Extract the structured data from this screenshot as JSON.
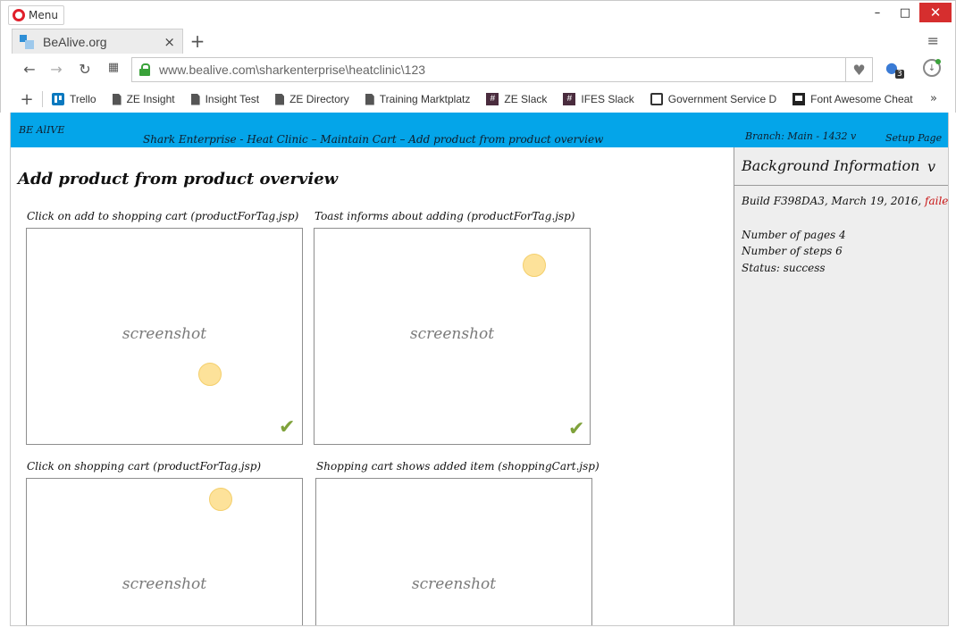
{
  "browser": {
    "menu_label": "Menu",
    "tab_title": "BeAlive.org",
    "url": "www.bealive.com\\sharkenterprise\\heatclinic\\123",
    "extension_badge": "3",
    "bookmarks": [
      {
        "label": "Trello",
        "icon": "trello-icon"
      },
      {
        "label": "ZE Insight",
        "icon": "page-icon"
      },
      {
        "label": "Insight Test",
        "icon": "page-icon"
      },
      {
        "label": "ZE Directory",
        "icon": "page-icon"
      },
      {
        "label": "Training Marktplatz",
        "icon": "page-icon"
      },
      {
        "label": "ZE Slack",
        "icon": "slack-icon"
      },
      {
        "label": "IFES Slack",
        "icon": "slack-icon"
      },
      {
        "label": "Government Service D",
        "icon": "government-icon"
      },
      {
        "label": "Font Awesome Cheat",
        "icon": "font-awesome-icon"
      }
    ]
  },
  "app": {
    "brand": "BE AlIVE",
    "breadcrumb": "Shark Enterprise - Heat Clinic – Maintain Cart – Add product from product overview",
    "branch": "Branch: Main - 1432 v",
    "setup": "Setup Page",
    "accent_color": "#04a5e9"
  },
  "main": {
    "heading": "Add product from product overview",
    "steps": [
      {
        "title": "Click on add to shopping cart (productForTag.jsp)",
        "placeholder": "screenshot",
        "status": "success"
      },
      {
        "title": "Toast informs about adding (productForTag.jsp)",
        "placeholder": "screenshot",
        "status": "success"
      },
      {
        "title": "Click on shopping cart (productForTag.jsp)",
        "placeholder": "screenshot",
        "status": ""
      },
      {
        "title": "Shopping cart shows added item (shoppingCart.jsp)",
        "placeholder": "screenshot",
        "status": ""
      }
    ]
  },
  "sidebar": {
    "title": "Background Information",
    "chevron": "v",
    "build_prefix": "Build F398DA3, March 19, 2016, ",
    "build_status": "failed",
    "pages": "Number of pages 4",
    "steps": "Number of steps 6",
    "status": "Status: success"
  }
}
